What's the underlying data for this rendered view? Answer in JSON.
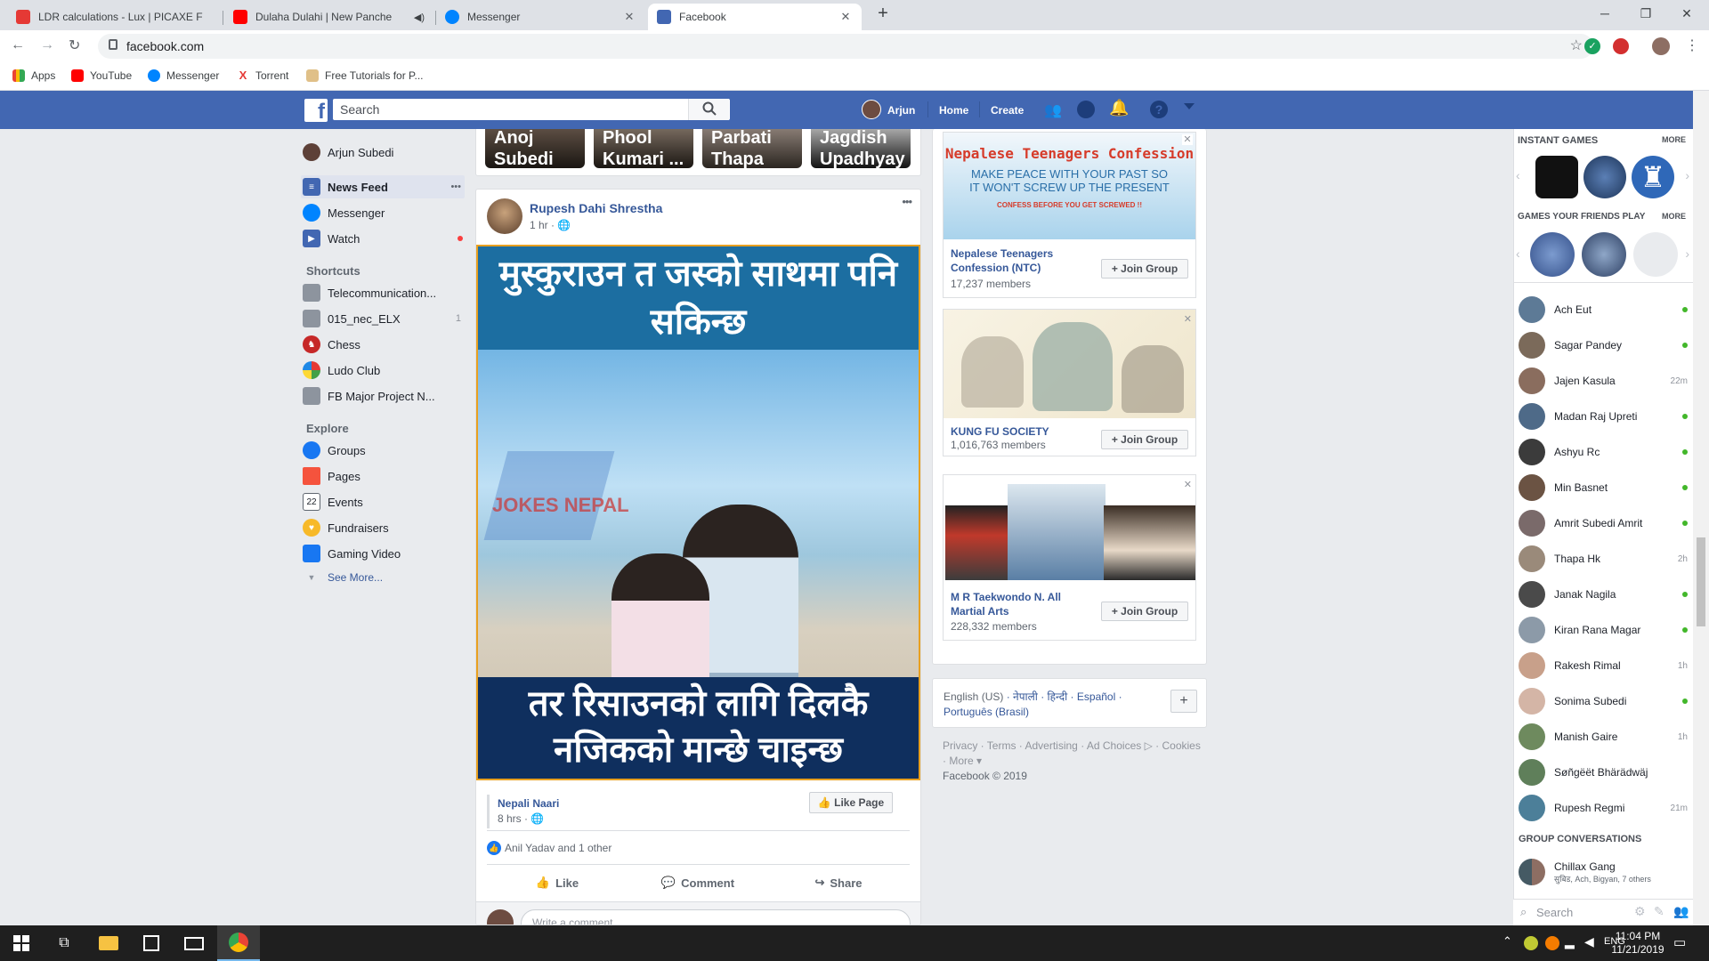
{
  "browser": {
    "tabs": [
      {
        "title": "LDR calculations - Lux | PICAXE F",
        "color": "#e53935"
      },
      {
        "title": "Dulaha Dulahi | New Panche",
        "color": "#ff0000"
      },
      {
        "title": "Messenger",
        "color": "#0084ff"
      },
      {
        "title": "Facebook",
        "color": "#4267b2"
      }
    ],
    "new_tab": "+",
    "url": "facebook.com",
    "bookmarks": [
      "Apps",
      "YouTube",
      "Messenger",
      "Torrent",
      "Free Tutorials for P..."
    ]
  },
  "fbnav": {
    "logo": "f",
    "search_placeholder": "Search",
    "user": "Arjun",
    "home": "Home",
    "create": "Create"
  },
  "leftnav": {
    "user": "Arjun Subedi",
    "items": [
      {
        "label": "News Feed",
        "color": "#4267b2",
        "extra": "•••"
      },
      {
        "label": "Messenger",
        "color": "#0084ff"
      },
      {
        "label": "Watch",
        "color": "#4267b2"
      }
    ],
    "shortcuts_title": "Shortcuts",
    "shortcuts": [
      {
        "label": "Telecommunication...",
        "count": ""
      },
      {
        "label": "015_nec_ELX",
        "count": "1"
      },
      {
        "label": "Chess",
        "count": ""
      },
      {
        "label": "Ludo Club",
        "count": ""
      },
      {
        "label": "FB Major Project N...",
        "count": ""
      }
    ],
    "explore_title": "Explore",
    "explore": [
      "Groups",
      "Pages",
      "Events",
      "Fundraisers",
      "Gaming Video"
    ],
    "see_more": "See More..."
  },
  "stories": [
    "Anoj Subedi",
    "Phool Kumari ...",
    "Parbati Thapa",
    "Jagdish Upadhyay"
  ],
  "post": {
    "author": "Rupesh Dahi Shrestha",
    "time": "1 hr",
    "more": "•••",
    "image_text_top": "मुस्कुराउन त जस्को साथमा पनि सकिन्छ",
    "watermark": "JOKES NEPAL",
    "image_text_bottom": "तर रिसाउनको लागि दिलकै नजिकको मान्छे चाइन्छ",
    "page_name": "Nepali Naari",
    "page_time": "8 hrs",
    "like_page": "Like Page",
    "reactions": "Anil Yadav and 1 other",
    "like": "Like",
    "comment": "Comment",
    "share": "Share",
    "comment_placeholder": "Write a comment..."
  },
  "ads": [
    {
      "banner_title": "Nepalese Teenagers Confession",
      "banner_line1": "MAKE PEACE WITH YOUR PAST SO",
      "banner_line2": "IT WON'T SCREW UP THE PRESENT",
      "banner_line3": "CONFESS BEFORE YOU GET SCREWED !!",
      "name": "Nepalese Teenagers Confession (NTC)",
      "members": "17,237 members",
      "join": "Join Group"
    },
    {
      "name": "KUNG FU SOCIETY",
      "members": "1,016,763 members",
      "join": "Join Group"
    },
    {
      "name": "M R Taekwondo N. All Martial Arts",
      "members": "228,332 members",
      "join": "Join Group"
    }
  ],
  "languages": {
    "items": [
      "English (US)",
      "नेपाली",
      "हिन्दी",
      "Español",
      "Português (Brasil)"
    ],
    "add": "+"
  },
  "footer": {
    "links": [
      "Privacy",
      "Terms",
      "Advertising",
      "Ad Choices",
      "Cookies",
      "More"
    ],
    "copyright": "Facebook © 2019"
  },
  "chat": {
    "instant_games": "INSTANT GAMES",
    "more1": "MORE",
    "friends_play": "GAMES YOUR FRIENDS PLAY",
    "more2": "MORE",
    "contacts": [
      {
        "name": "Ach Eut",
        "status": "online"
      },
      {
        "name": "Sagar Pandey",
        "status": "online"
      },
      {
        "name": "Jajen Kasula",
        "status": "22m"
      },
      {
        "name": "Madan Raj Upreti",
        "status": "online"
      },
      {
        "name": "Ashyu Rc",
        "status": "online"
      },
      {
        "name": "Min Basnet",
        "status": "online"
      },
      {
        "name": "Amrit Subedi Amrit",
        "status": "online"
      },
      {
        "name": "Thapa Hk",
        "status": "2h"
      },
      {
        "name": "Janak Nagila",
        "status": "online"
      },
      {
        "name": "Kiran Rana Magar",
        "status": "online"
      },
      {
        "name": "Rakesh Rimal",
        "status": "1h"
      },
      {
        "name": "Sonima Subedi",
        "status": "online"
      },
      {
        "name": "Manish Gaire",
        "status": "1h"
      },
      {
        "name": "Søñgëët Bhärädwäj",
        "status": ""
      },
      {
        "name": "Rupesh Regmi",
        "status": "21m"
      }
    ],
    "group_title": "GROUP CONVERSATIONS",
    "group_name": "Chillax Gang",
    "group_members": "सुबिड, Ach, Bigyan, 7 others",
    "search": "Search"
  },
  "taskbar": {
    "time": "11:04 PM",
    "date": "11/21/2019"
  }
}
